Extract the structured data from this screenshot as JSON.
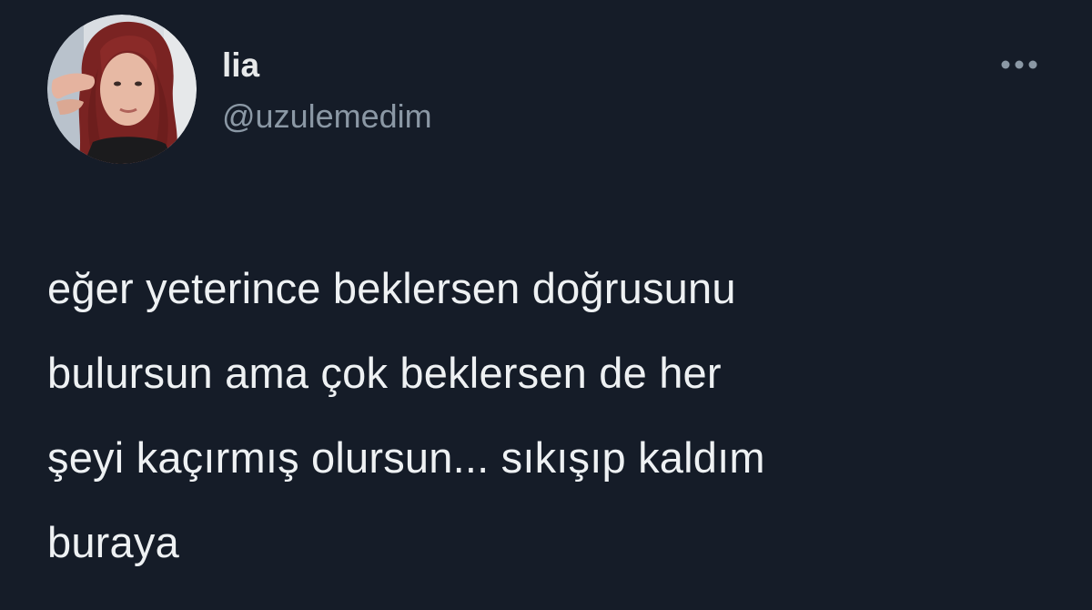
{
  "tweet": {
    "author": {
      "display_name": "lia",
      "handle": "@uzulemedim",
      "avatar_icon": "profile-photo"
    },
    "more_icon": "more-horizontal-icon",
    "text": "eğer yeterince beklersen doğrusunu\nbulursun ama çok beklersen de her\nşeyi kaçırmış olursun... sıkışıp kaldım\nburaya"
  },
  "colors": {
    "background": "#151c28",
    "primary_text": "#e7e9ea",
    "secondary_text": "#8b98a5"
  }
}
